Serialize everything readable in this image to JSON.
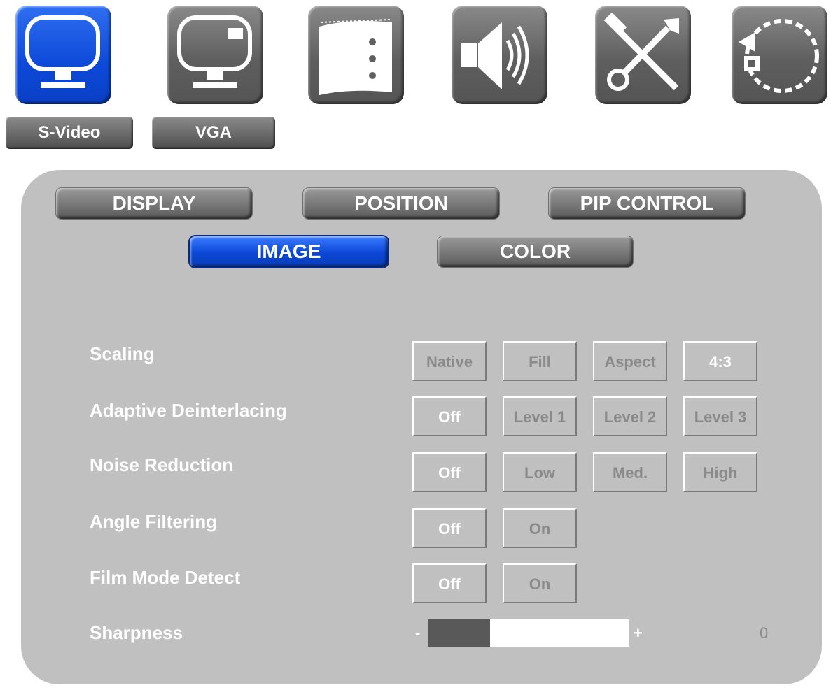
{
  "top_icons": [
    {
      "name": "s-video-input-icon",
      "active": true
    },
    {
      "name": "vga-input-icon",
      "active": false
    },
    {
      "name": "film-strip-icon",
      "active": false
    },
    {
      "name": "speaker-audio-icon",
      "active": false
    },
    {
      "name": "tools-icon",
      "active": false
    },
    {
      "name": "reset-rotate-icon",
      "active": false
    }
  ],
  "sources": {
    "s_video": "S-Video",
    "vga": "VGA"
  },
  "tabs": {
    "display": "DISPLAY",
    "position": "POSITION",
    "pip_control": "PIP CONTROL"
  },
  "subtabs": {
    "image": "IMAGE",
    "color": "COLOR",
    "active": "IMAGE"
  },
  "settings": {
    "scaling": {
      "label": "Scaling",
      "options": [
        "Native",
        "Fill",
        "Aspect",
        "4:3"
      ],
      "selected": "4:3"
    },
    "deinterlacing": {
      "label": "Adaptive Deinterlacing",
      "options": [
        "Off",
        "Level 1",
        "Level 2",
        "Level 3"
      ],
      "selected": "Off"
    },
    "noise": {
      "label": "Noise Reduction",
      "options": [
        "Off",
        "Low",
        "Med.",
        "High"
      ],
      "selected": "Off"
    },
    "angle": {
      "label": "Angle Filtering",
      "options": [
        "Off",
        "On"
      ],
      "selected": "Off"
    },
    "film": {
      "label": "Film Mode Detect",
      "options": [
        "Off",
        "On"
      ],
      "selected": "Off"
    },
    "sharpness": {
      "label": "Sharpness",
      "minus": "-",
      "plus": "+",
      "value": "0",
      "level": 0.31
    }
  },
  "colors": {
    "accent_blue": "#0d49d8",
    "panel": "#c0c0c0",
    "button_gray": "#5f5f5f"
  }
}
